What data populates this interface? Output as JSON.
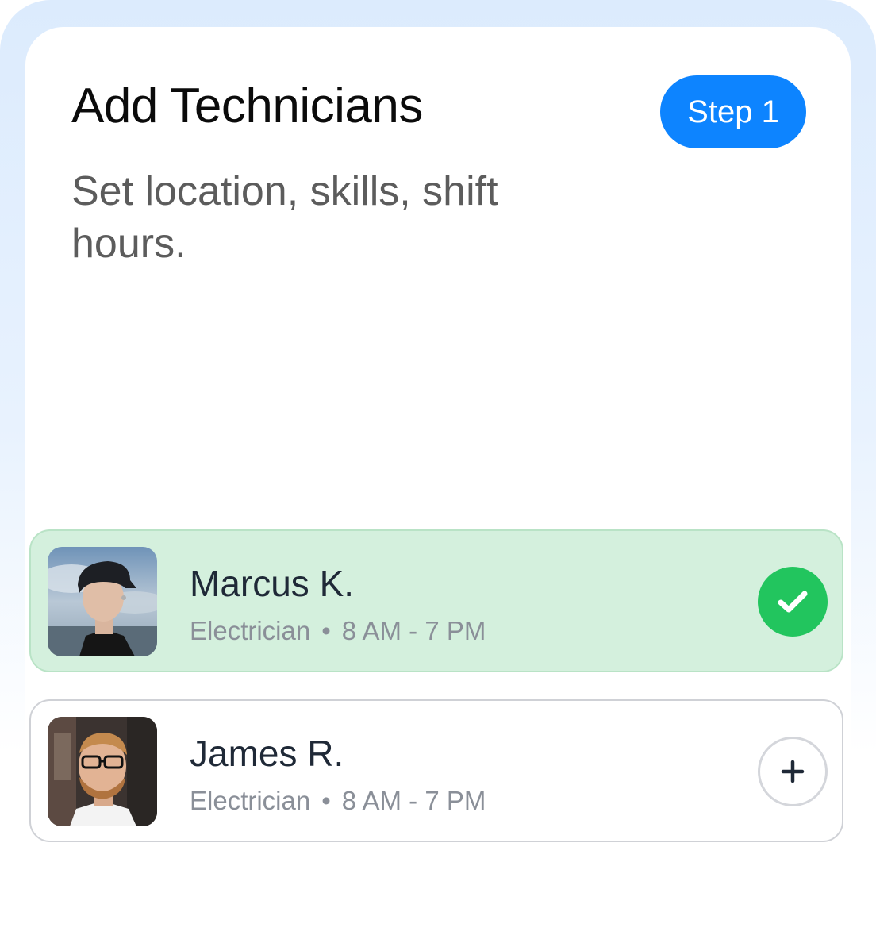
{
  "header": {
    "title": "Add Technicians",
    "step_label": "Step 1",
    "subtitle": "Set location, skills, shift hours."
  },
  "technicians": [
    {
      "name": "Marcus K.",
      "role": "Electrician",
      "separator": "•",
      "hours": "8 AM - 7 PM",
      "selected": true,
      "status_icon": "check-icon"
    },
    {
      "name": "James R.",
      "role": "Electrician",
      "separator": "•",
      "hours": "8 AM - 7 PM",
      "selected": false,
      "status_icon": "plus-icon"
    }
  ],
  "colors": {
    "accent": "#0d84ff",
    "selected_bg": "#d4f0dd",
    "check_green": "#22c55e",
    "text_primary": "#1f2937",
    "text_secondary": "#8a8f98"
  }
}
